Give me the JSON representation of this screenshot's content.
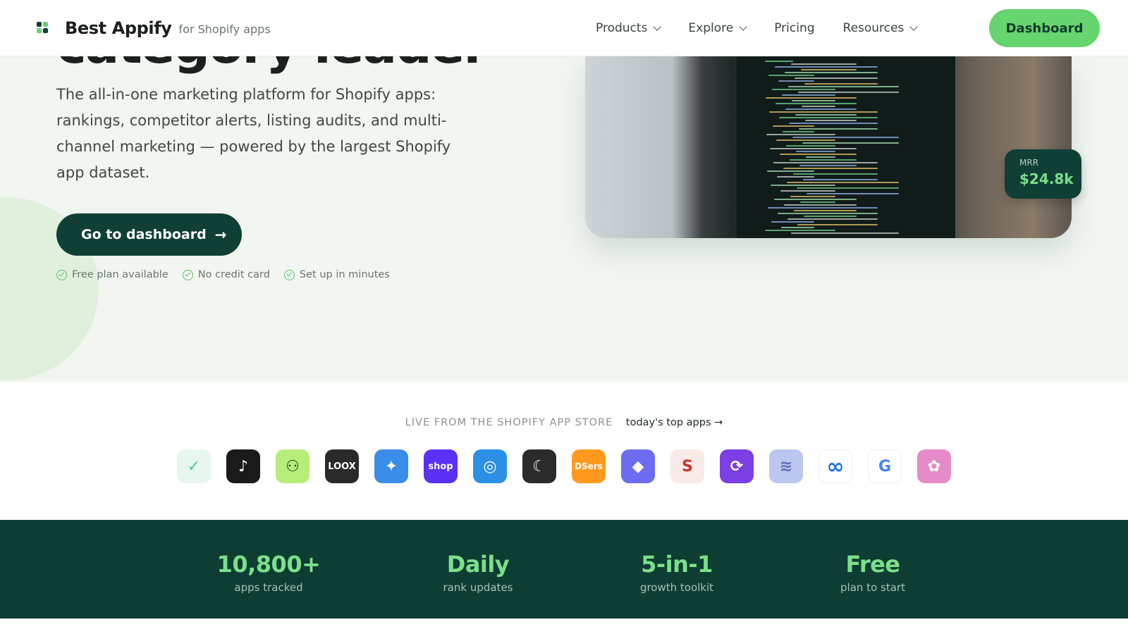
{
  "nav": {
    "brand": "Best Appify",
    "brand_sub": "for Shopify apps",
    "items": [
      {
        "label": "Products",
        "has_dropdown": true
      },
      {
        "label": "Explore",
        "has_dropdown": true
      },
      {
        "label": "Pricing",
        "has_dropdown": false
      },
      {
        "label": "Resources",
        "has_dropdown": true
      }
    ],
    "dashboard_button": "Dashboard"
  },
  "hero": {
    "title_partial": "category leader",
    "description": "The all-in-one marketing platform for Shopify apps: rankings, competitor alerts, listing audits, and multi-channel marketing — powered by the largest Shopify app dataset.",
    "cta": "Go to dashboard",
    "cta_arrow": "→",
    "checks": [
      "Free plan available",
      "No credit card",
      "Set up in minutes"
    ],
    "mrr_label": "MRR",
    "mrr_value": "$24.8k"
  },
  "live": {
    "label": "LIVE FROM THE SHOPIFY APP STORE",
    "link": "today's top apps →"
  },
  "apps": [
    {
      "name": "checkmark-app-icon",
      "bg": "#e7f7ee",
      "fg": "#4cc9a0",
      "glyph": "✓"
    },
    {
      "name": "tiktok-icon",
      "bg": "#1a1a1a",
      "fg": "#ffffff",
      "glyph": "♪"
    },
    {
      "name": "nodes-app-icon",
      "bg": "#b7ee7a",
      "fg": "#1a3a1a",
      "glyph": "⚇"
    },
    {
      "name": "loox-icon",
      "bg": "#2a2a2a",
      "fg": "#ffffff",
      "glyph": "LOOX"
    },
    {
      "name": "globe-app-icon",
      "bg": "#3a8de8",
      "fg": "#ffffff",
      "glyph": "✦"
    },
    {
      "name": "shop-icon",
      "bg": "#5a31f4",
      "fg": "#ffffff",
      "glyph": "shop"
    },
    {
      "name": "target-app-icon",
      "bg": "#2b8fe6",
      "fg": "#ffffff",
      "glyph": "◎"
    },
    {
      "name": "crescent-app-icon",
      "bg": "#2b2b2b",
      "fg": "#ffffff",
      "glyph": "☾"
    },
    {
      "name": "dsers-icon",
      "bg": "#ff9a1f",
      "fg": "#ffffff",
      "glyph": "DSers"
    },
    {
      "name": "diamond-grid-app-icon",
      "bg": "#6d6cf0",
      "fg": "#ffffff",
      "glyph": "◆"
    },
    {
      "name": "s-app-icon",
      "bg": "#fbe9e7",
      "fg": "#c9342b",
      "glyph": "S"
    },
    {
      "name": "orbit-app-icon",
      "bg": "#7b3fe4",
      "fg": "#ffffff",
      "glyph": "⟳"
    },
    {
      "name": "layers-app-icon",
      "bg": "#bcc7ef",
      "fg": "#5a6fb8",
      "glyph": "≋"
    },
    {
      "name": "meta-icon",
      "bg": "#ffffff",
      "fg": "#1b74e4",
      "glyph": "∞"
    },
    {
      "name": "google-icon",
      "bg": "#ffffff",
      "fg": "#4285f4",
      "glyph": "G"
    },
    {
      "name": "pink-app-icon",
      "bg": "#e58bc9",
      "fg": "#ffffff",
      "glyph": "✿"
    }
  ],
  "stats": [
    {
      "value": "10,800+",
      "label": "apps tracked"
    },
    {
      "value": "Daily",
      "label": "rank updates"
    },
    {
      "value": "5-in-1",
      "label": "growth toolkit"
    },
    {
      "value": "Free",
      "label": "plan to start"
    }
  ],
  "colors": {
    "accent_green": "#66d46f",
    "dark_green": "#0f3f35",
    "hero_bg": "#f1f6f0"
  }
}
